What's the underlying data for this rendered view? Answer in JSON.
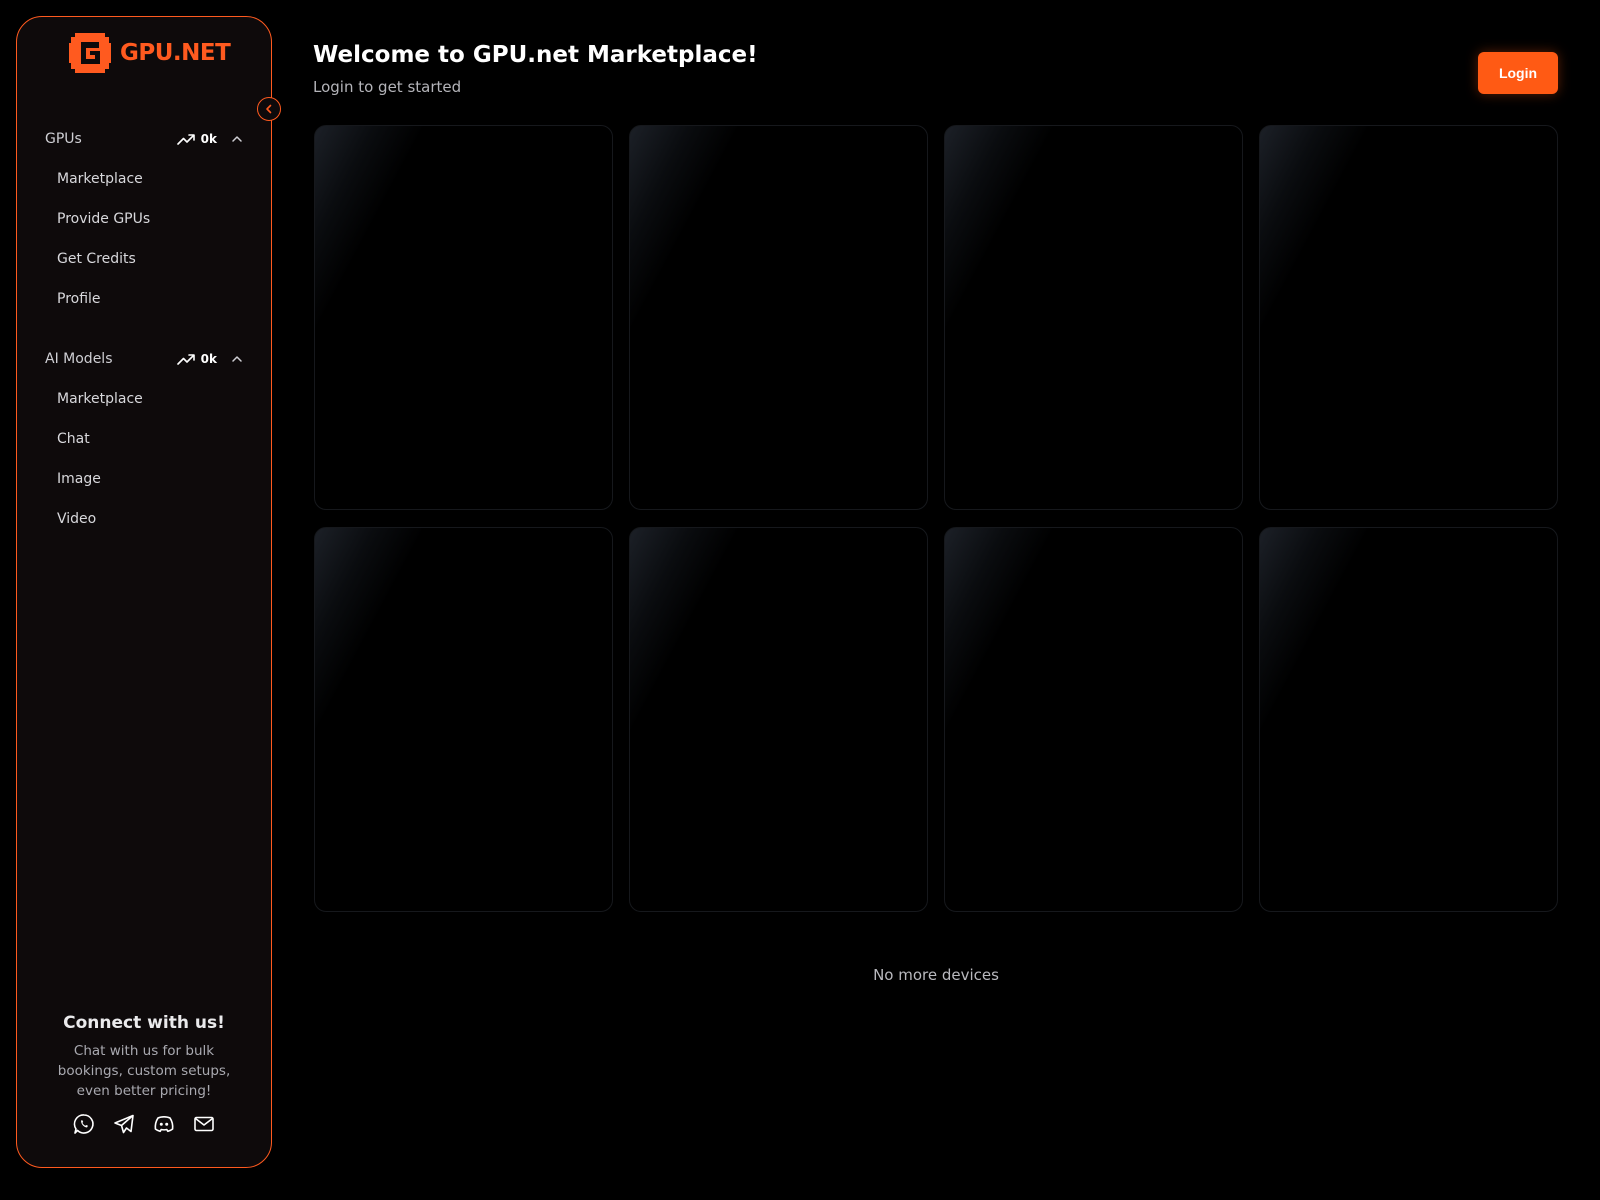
{
  "brand": {
    "name": "GPU.NET",
    "accent": "#ff5a1f"
  },
  "sidebar": {
    "sections": [
      {
        "title": "GPUs",
        "stat": "0k",
        "items": [
          {
            "label": "Marketplace"
          },
          {
            "label": "Provide GPUs"
          },
          {
            "label": "Get Credits"
          },
          {
            "label": "Profile"
          }
        ]
      },
      {
        "title": "AI Models",
        "stat": "0k",
        "items": [
          {
            "label": "Marketplace"
          },
          {
            "label": "Chat"
          },
          {
            "label": "Image"
          },
          {
            "label": "Video"
          }
        ]
      }
    ],
    "connect": {
      "title": "Connect with us!",
      "description": "Chat with us for bulk bookings, custom setups, even better pricing!",
      "socials": [
        "whatsapp-icon",
        "telegram-icon",
        "discord-icon",
        "mail-icon"
      ]
    }
  },
  "header": {
    "title": "Welcome to GPU.net Marketplace!",
    "subtitle": "Login to get started",
    "login_label": "Login"
  },
  "main": {
    "placeholder_cards": 8,
    "empty_message": "No more devices"
  }
}
